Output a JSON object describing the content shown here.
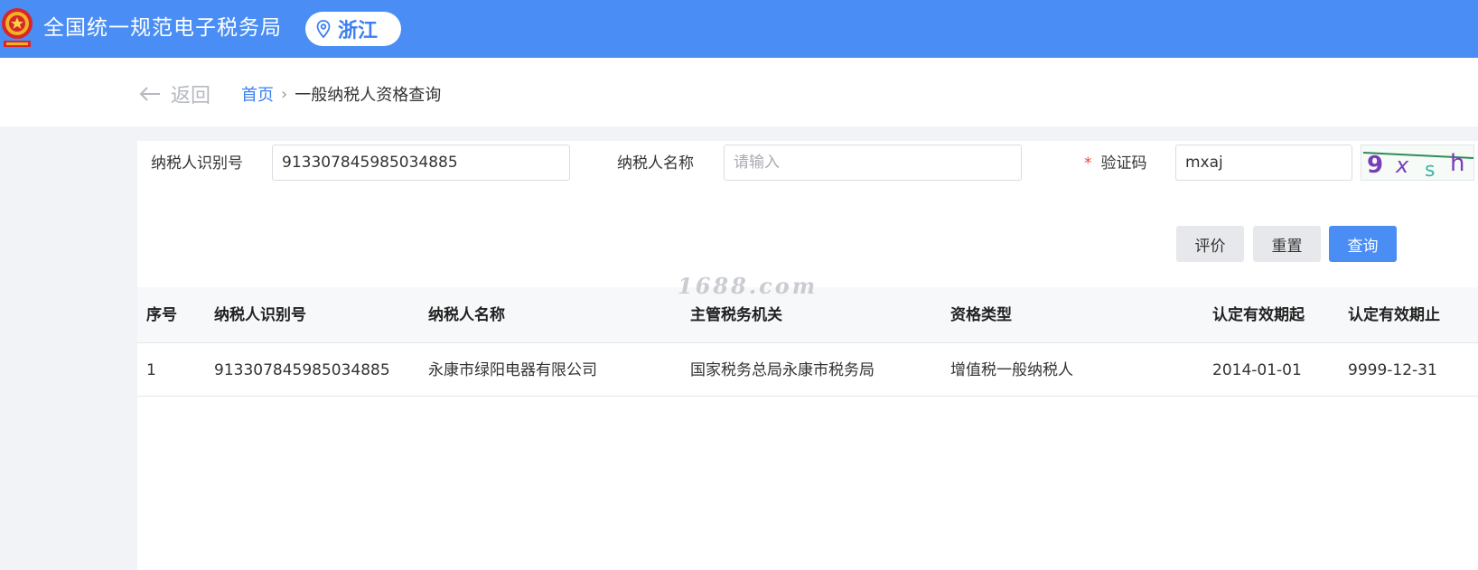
{
  "header": {
    "site_title": "全国统一规范电子税务局",
    "region": "浙江",
    "brand_color": "#4a8ef5"
  },
  "subbar": {
    "back_label": "返回",
    "breadcrumb_home": "首页",
    "breadcrumb_separator": "›",
    "breadcrumb_current": "一般纳税人资格查询"
  },
  "form": {
    "taxpayer_id_label": "纳税人识别号",
    "taxpayer_id_value": "913307845985034885",
    "taxpayer_name_label": "纳税人名称",
    "taxpayer_name_value": "",
    "taxpayer_name_placeholder": "请输入",
    "required_mark": "*",
    "captcha_label": "验证码",
    "captcha_value": "mxaj",
    "captcha_image_text": "9xsh"
  },
  "buttons": {
    "rate": "评价",
    "reset": "重置",
    "search": "查询"
  },
  "watermark": "1688.com",
  "table": {
    "columns": [
      "序号",
      "纳税人识别号",
      "纳税人名称",
      "主管税务机关",
      "资格类型",
      "认定有效期起",
      "认定有效期止"
    ],
    "rows": [
      [
        "1",
        "913307845985034885",
        "永康市绿阳电器有限公司",
        "国家税务总局永康市税务局",
        "增值税一般纳税人",
        "2014-01-01",
        "9999-12-31"
      ]
    ]
  }
}
